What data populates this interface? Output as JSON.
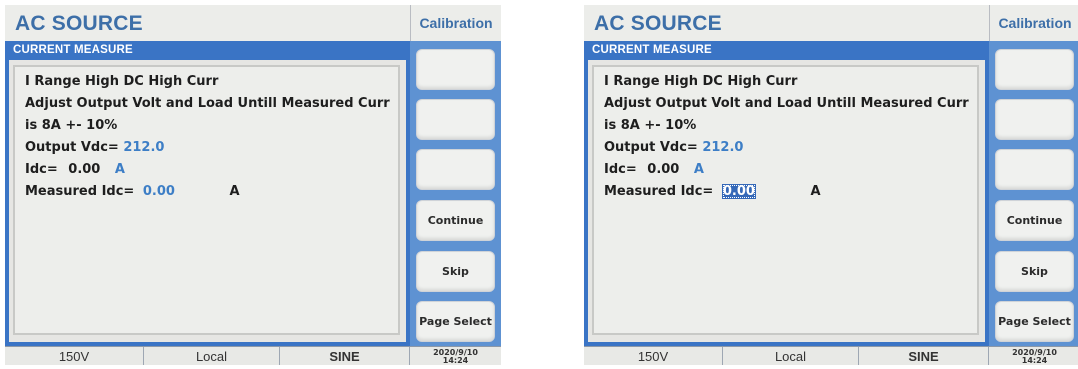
{
  "screens": [
    {
      "app_title": "AC SOURCE",
      "page_label": "Calibration",
      "panel_title": "CURRENT MEASURE",
      "lines": {
        "range": "I Range High DC High Curr",
        "instruction": "Adjust Output Volt and Load Untill Measured Curr",
        "target": "is 8A +- 10%",
        "output_vdc_label": "Output Vdc=",
        "output_vdc_value": "212.0",
        "idc_label": "Idc=",
        "idc_value": "0.00",
        "idc_unit": "A",
        "measured_idc_label": "Measured Idc=",
        "measured_idc_value": "0.00",
        "measured_idc_unit": "A"
      },
      "measured_field_selected": false,
      "soft_keys": [
        "",
        "",
        "",
        "Continue",
        "Skip",
        "Page Select"
      ],
      "status": {
        "range": "150V",
        "mode": "Local",
        "waveform": "SINE",
        "date": "2020/9/10",
        "time": "14:24"
      }
    },
    {
      "app_title": "AC SOURCE",
      "page_label": "Calibration",
      "panel_title": "CURRENT MEASURE",
      "lines": {
        "range": "I Range High DC High Curr",
        "instruction": "Adjust Output Volt and Load Untill Measured Curr",
        "target": "is 8A +- 10%",
        "output_vdc_label": "Output Vdc=",
        "output_vdc_value": "212.0",
        "idc_label": "Idc=",
        "idc_value": "0.00",
        "idc_unit": "A",
        "measured_idc_label": "Measured Idc=",
        "measured_idc_value": "0.00",
        "measured_idc_unit": "A"
      },
      "measured_field_selected": true,
      "soft_keys": [
        "",
        "",
        "",
        "Continue",
        "Skip",
        "Page Select"
      ],
      "status": {
        "range": "150V",
        "mode": "Local",
        "waveform": "SINE",
        "date": "2020/9/10",
        "time": "14:24"
      }
    }
  ],
  "colors": {
    "title_blue": "#3d6fa8",
    "panel_blue": "#3a74c5",
    "softkey_column_blue": "#5e92d2",
    "value_blue": "#3d7ec6",
    "selection_blue": "#3468b8"
  }
}
